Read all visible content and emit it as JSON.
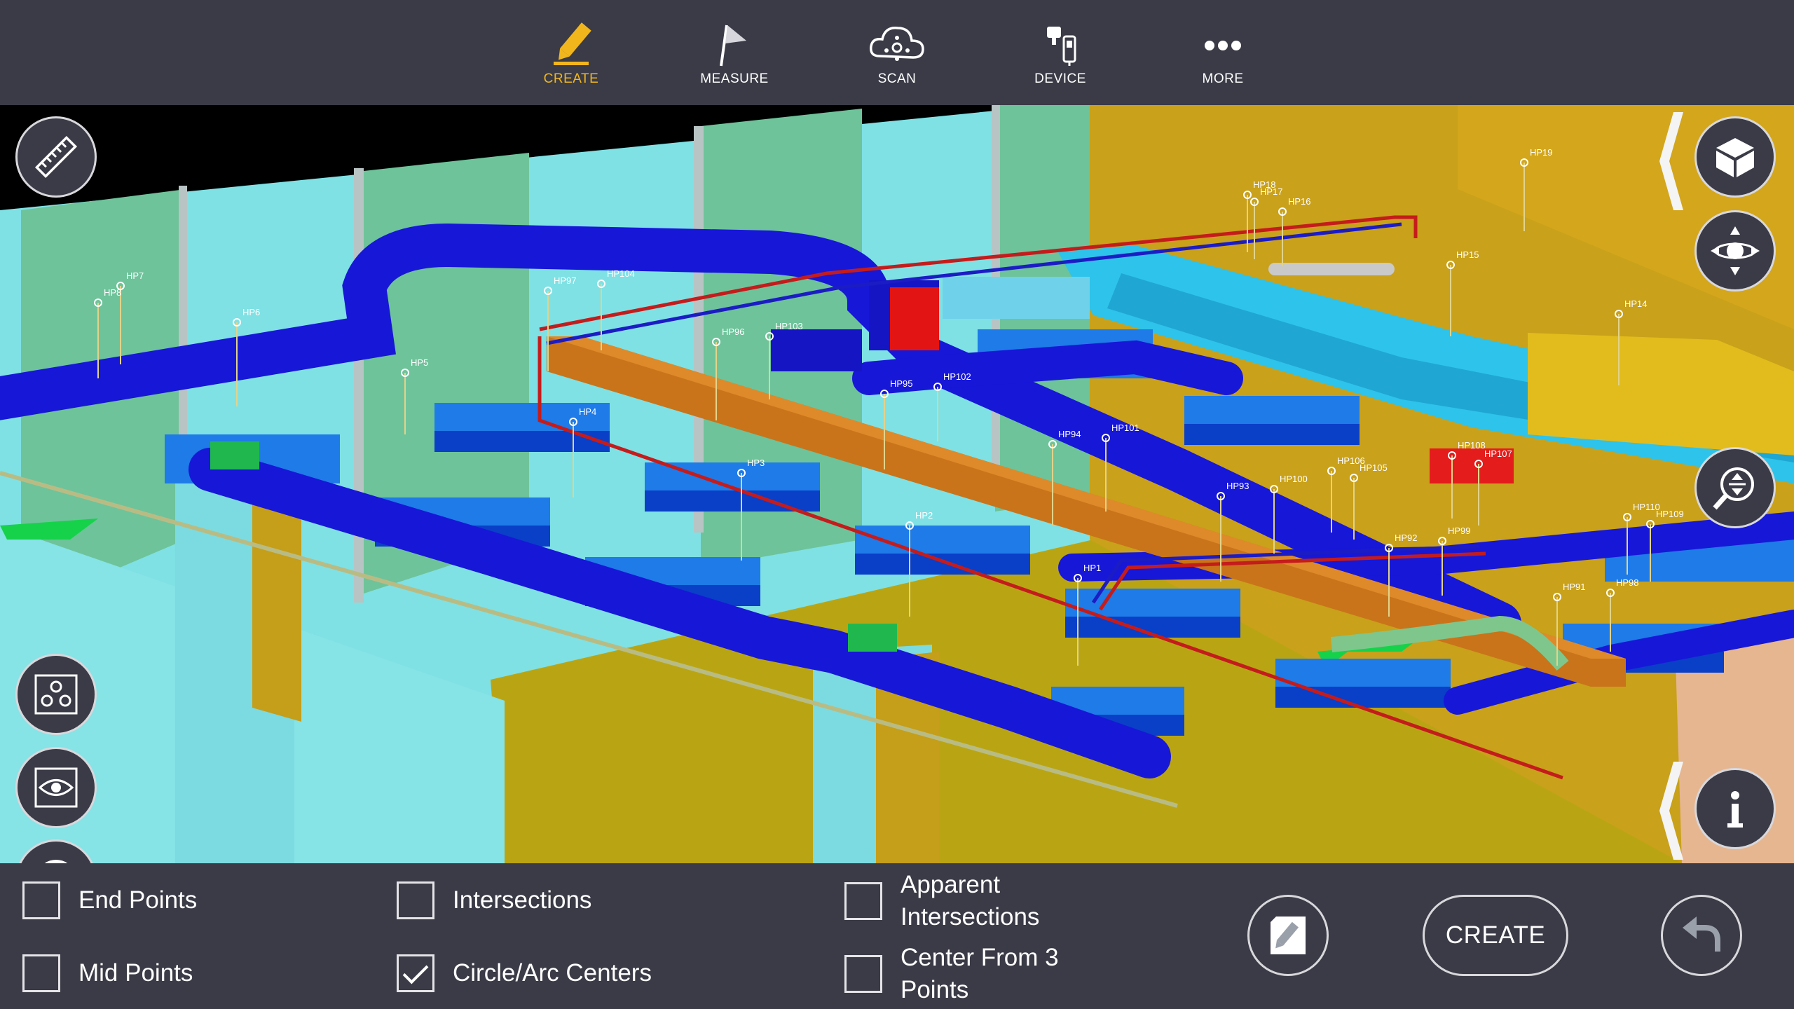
{
  "toolbar": {
    "tabs": [
      {
        "label": "CREATE",
        "icon": "pencil-icon",
        "active": true
      },
      {
        "label": "MEASURE",
        "icon": "flag-icon",
        "active": false
      },
      {
        "label": "SCAN",
        "icon": "cloud-scan-icon",
        "active": false
      },
      {
        "label": "DEVICE",
        "icon": "device-icon",
        "active": false
      },
      {
        "label": "MORE",
        "icon": "more-icon",
        "active": false
      }
    ]
  },
  "viewport": {
    "hanger_points": [
      "HP1",
      "HP2",
      "HP3",
      "HP4",
      "HP5",
      "HP6",
      "HP7",
      "HP8",
      "HP14",
      "HP15",
      "HP16",
      "HP17",
      "HP18",
      "HP19",
      "HP91",
      "HP92",
      "HP93",
      "HP94",
      "HP95",
      "HP96",
      "HP97",
      "HP98",
      "HP99",
      "HP100",
      "HP101",
      "HP102",
      "HP103",
      "HP104",
      "HP105",
      "HP106",
      "HP107",
      "HP108",
      "HP109",
      "HP110"
    ]
  },
  "left_controls": [
    "ruler-icon",
    "snap-points-icon",
    "visibility-icon",
    "cancel-icon"
  ],
  "right_controls": [
    "cube-view-icon",
    "orbit-icon",
    "zoom-extents-icon",
    "info-icon"
  ],
  "snaps": {
    "end_points": {
      "label": "End Points",
      "checked": false
    },
    "mid_points": {
      "label": "Mid Points",
      "checked": false
    },
    "intersections": {
      "label": "Intersections",
      "checked": false
    },
    "circle_arc_centers": {
      "label": "Circle/Arc Centers",
      "checked": true
    },
    "apparent_intersections": {
      "label": "Apparent Intersections",
      "checked": false
    },
    "center_from_3_points": {
      "label": "Center From 3 Points",
      "checked": false
    }
  },
  "actions": {
    "create_label": "CREATE"
  },
  "colors": {
    "accent": "#f2b61d",
    "toolbar_bg": "#3a3b46",
    "duct_blue": "#1a1adb",
    "equipment_blue": "#1e7be8",
    "wall_cyan": "#87e4e8",
    "floor_yellow": "#b8a312",
    "beam_orange": "#c9741a"
  }
}
